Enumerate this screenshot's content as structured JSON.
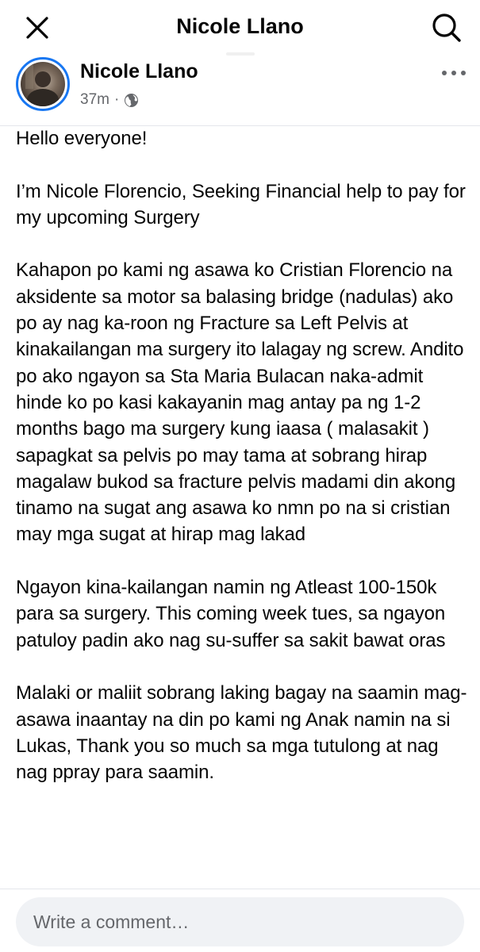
{
  "header": {
    "title": "Nicole Llano",
    "close_icon": "close-icon",
    "search_icon": "search-icon"
  },
  "post": {
    "author": "Nicole Llano",
    "time": "37m",
    "separator": "·",
    "privacy_icon": "globe-icon",
    "more_icon": "more-horizontal-icon",
    "paragraphs": [
      "Hello everyone!",
      "I’m Nicole Florencio, Seeking Financial help to pay for my upcoming Surgery",
      "Kahapon po kami ng asawa ko Cristian Florencio na aksidente sa motor sa balasing bridge (nadulas) ako po ay nag ka-roon ng Fracture sa Left Pelvis at kinakailangan ma surgery ito lalagay ng screw. Andito po ako ngayon sa Sta Maria Bulacan naka-admit hinde ko po kasi kakayanin mag antay pa ng 1-2 months bago ma surgery kung iaasa ( malasakit ) sapagkat sa pelvis po may tama at sobrang hirap magalaw bukod sa fracture pelvis madami din akong tinamo na sugat ang asawa ko nmn po na si cristian may mga sugat at hirap mag lakad",
      "Ngayon kina-kailangan namin ng Atleast 100-150k para sa surgery. This coming week tues, sa ngayon patuloy padin ako nag su-suffer sa sakit bawat oras",
      "Malaki or maliit sobrang laking bagay na saamin mag-asawa inaantay na din po kami ng Anak namin na si Lukas, Thank you so much sa mga tutulong at nag nag ppray para saamin."
    ]
  },
  "comment": {
    "placeholder": "Write a comment…"
  },
  "colors": {
    "accent": "#1877f2",
    "text": "#050505",
    "secondary": "#65676b",
    "input_bg": "#f0f2f5"
  }
}
